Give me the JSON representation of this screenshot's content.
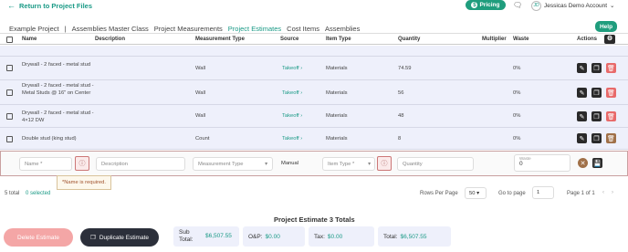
{
  "topbar": {
    "back_label": "Return to Project Files",
    "pricing_label": "Pricing",
    "account_initials": "JD",
    "account_name": "Jessicas Demo Account"
  },
  "breadcrumbs": [
    "Example Project",
    "Assemblies Master Class",
    "Project Measurements",
    "Project Estimates",
    "Cost Items",
    "Assemblies"
  ],
  "help_label": "Help",
  "table": {
    "headers": [
      "Name",
      "Description",
      "Measurement Type",
      "Source",
      "Item Type",
      "Quantity",
      "Multiplier",
      "Waste",
      "Actions"
    ],
    "rows": [
      {
        "name": "Drywall - 2 faced - metal stud",
        "measurement": "Wall",
        "source": "Takeoff ›",
        "item_type": "Materials",
        "quantity": "74.59",
        "waste": "0%"
      },
      {
        "name": "Drywall - 2 faced - metal stud - Metal Studs @ 16\" on Center",
        "measurement": "Wall",
        "source": "Takeoff ›",
        "item_type": "Materials",
        "quantity": "56",
        "waste": "0%"
      },
      {
        "name": "Drywall - 2 faced - metal stud - 4×12 DW",
        "measurement": "Wall",
        "source": "Takeoff ›",
        "item_type": "Materials",
        "quantity": "48",
        "waste": "0%"
      },
      {
        "name": "Double stud (king stud)",
        "measurement": "Count",
        "source": "Takeoff ›",
        "item_type": "Materials",
        "quantity": "8",
        "waste": "0%"
      }
    ],
    "new_row": {
      "name_placeholder": "Name *",
      "description_placeholder": "Description",
      "measurement_placeholder": "Measurement Type",
      "source_value": "Manual",
      "item_type_placeholder": "Item Type *",
      "quantity_placeholder": "Quantity",
      "waste_label": "Waste",
      "waste_value": "0"
    },
    "error_message": "*Name is required."
  },
  "pagination": {
    "total": "5 total",
    "selected": "0 selected",
    "rows_per_page_label": "Rows Per Page",
    "rows_per_page": "50",
    "go_to_page_label": "Go to page",
    "go_to_page_value": "1",
    "page_of": "Page 1 of 1"
  },
  "totals": {
    "title": "Project Estimate 3 Totals",
    "subtotal_label": "Sub Total:",
    "subtotal_value": "$6,507.55",
    "op_label": "O&P:",
    "op_value": "$0.00",
    "tax_label": "Tax:",
    "tax_value": "$0.00",
    "total_label": "Total:",
    "total_value": "$6,507.55"
  },
  "buttons": {
    "delete_label": "Delete Estimate",
    "duplicate_label": "Duplicate Estimate"
  }
}
